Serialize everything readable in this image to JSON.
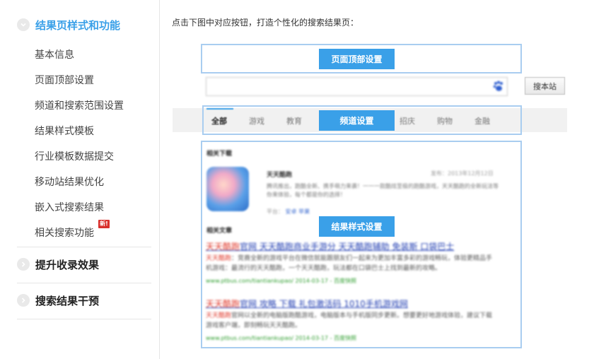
{
  "sidebar": {
    "groups": [
      {
        "label": "结果页样式和功能",
        "expanded": true,
        "items": [
          {
            "label": "基本信息"
          },
          {
            "label": "页面顶部设置"
          },
          {
            "label": "频道和搜索范围设置"
          },
          {
            "label": "结果样式模板"
          },
          {
            "label": "行业模板数据提交"
          },
          {
            "label": "移动站结果优化"
          },
          {
            "label": "嵌入式搜索结果"
          },
          {
            "label": "相关搜索功能",
            "badge": "新!"
          }
        ]
      },
      {
        "label": "提升收录效果",
        "expanded": false
      },
      {
        "label": "搜索结果干预",
        "expanded": false
      }
    ]
  },
  "main": {
    "intro": "点击下图中对应按钮，打造个性化的搜索结果页：",
    "top_setting_label": "页面顶部设置",
    "channel_setting_label": "频道设置",
    "result_style_label": "结果样式设置",
    "search_button_label": "搜本站",
    "tabs": [
      {
        "label": "全部",
        "active": true
      },
      {
        "label": "游戏"
      },
      {
        "label": "教育"
      },
      {
        "label": "招庆"
      },
      {
        "label": "购物"
      },
      {
        "label": "金融"
      }
    ],
    "related_download": {
      "heading": "相关下载",
      "app_title": "天天酷跑",
      "date": "发布：2013年12月12日",
      "desc": "腾讯推出，跑酷全新、携手萌力来袭！一一一款酷炫至极的跑酷游戏，天天酷跑的全新玩法等你来体验，每个都是你的选择！",
      "meta_prefix": "平台：",
      "meta_links": [
        "安卓",
        "苹果"
      ]
    },
    "related_articles": {
      "heading": "相关文章",
      "results": [
        {
          "title_hl": "天天酷跑",
          "title_rest": "官网 天天酷跑商业手游分 天天酷跑辅助 免装斯 口袋巴士",
          "desc_hl": "天天酷跑",
          "desc": "：竞赛全新的游戏平台在微信就能跟朋友们一起来为更加丰富多彩的游戏畅玩，体验更精品手机游戏：最流行的天天酷跑，一个天天酷跑，玩法都在口袋巴士上找到最新的攻略。",
          "url": "www.ptbus.com/tiantiankupao/ 2014-03-17 - 百度快照"
        },
        {
          "title_hl": "天天酷跑",
          "title_rest": "官网 攻略 下载 礼包激活码 1010手机游戏网",
          "desc_hl": "天天酷跑",
          "desc": "官网以全新的电脑版跑酷游戏，电脑版本与手机版同步更新。想要更好地游戏体验，建议下载游戏客户端，即刻畅玩天天酷跑。",
          "url": "www.ptbus.com/tiantiankupao/ 2014-03-17 - 百度快照"
        }
      ]
    }
  }
}
